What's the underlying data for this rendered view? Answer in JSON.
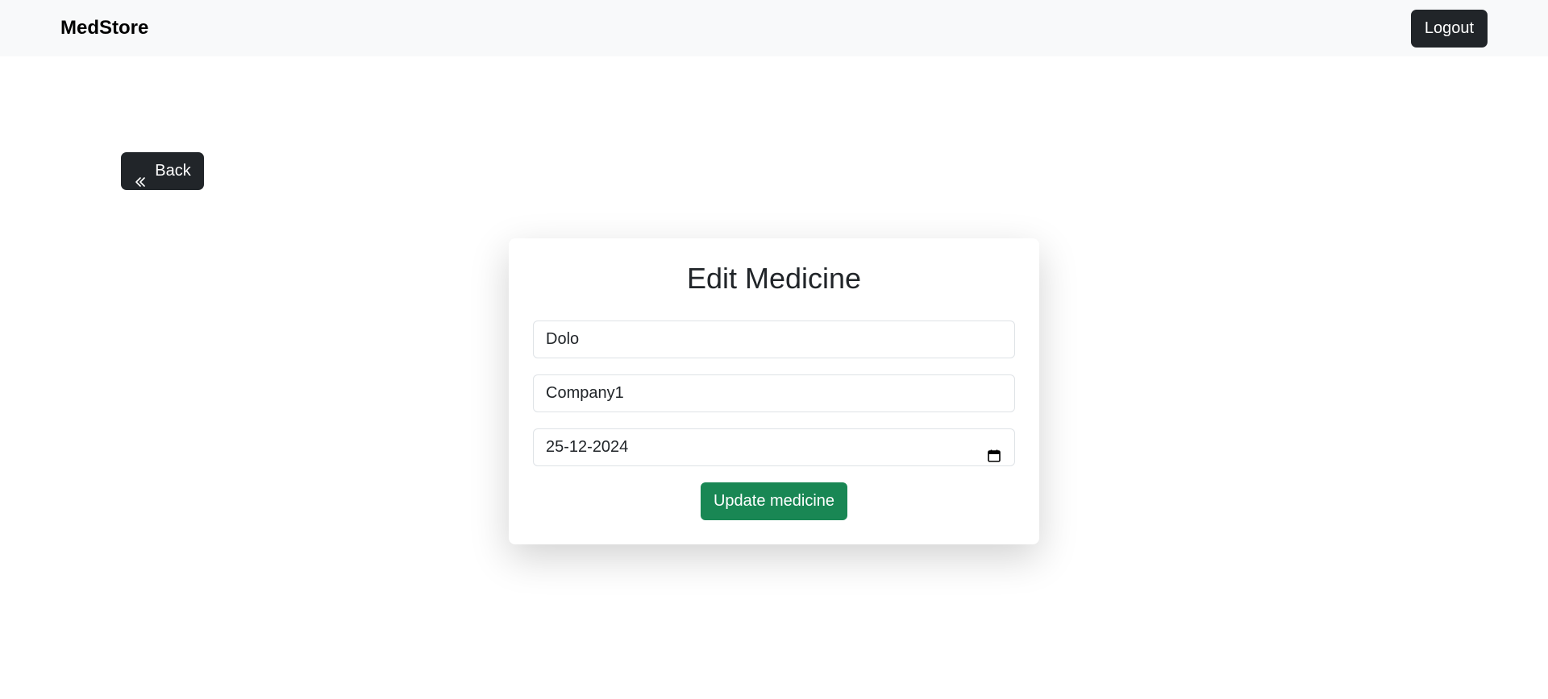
{
  "navbar": {
    "brand": "MedStore",
    "logout_label": "Logout"
  },
  "back": {
    "label": "Back",
    "icon": "double-chevron-left-icon"
  },
  "form": {
    "title": "Edit Medicine",
    "name_value": "Dolo",
    "company_value": "Company1",
    "expiry_value": "25-12-2024",
    "calendar_icon": "calendar-icon",
    "submit_label": "Update medicine"
  },
  "colors": {
    "navbar_bg": "#f8f9fa",
    "dark_button": "#212529",
    "success_button": "#198754"
  }
}
